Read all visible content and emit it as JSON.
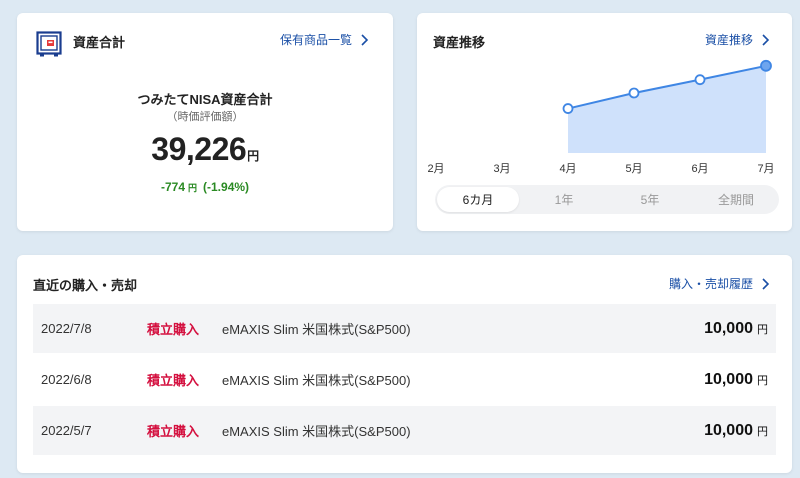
{
  "assets_card": {
    "title": "資産合計",
    "link_label": "保有商品一覧",
    "nisa_label": "つみたてNISA資産合計",
    "nisa_sub": "（時価評価額）",
    "total_value": "39,226",
    "total_unit": "円",
    "change_value": "-774",
    "change_unit": "円",
    "change_percent": "(-1.94%)"
  },
  "trend_card": {
    "title": "資産推移",
    "link_label": "資産推移",
    "tabs": [
      {
        "label": "6カ月",
        "active": true
      },
      {
        "label": "1年",
        "active": false
      },
      {
        "label": "5年",
        "active": false
      },
      {
        "label": "全期間",
        "active": false
      }
    ]
  },
  "history_card": {
    "title": "直近の購入・売却",
    "link_label": "購入・売却履歴",
    "rows": [
      {
        "date": "2022/7/8",
        "type": "積立購入",
        "fund": "eMAXIS Slim 米国株式(S&P500)",
        "amount": "10,000",
        "unit": "円"
      },
      {
        "date": "2022/6/8",
        "type": "積立購入",
        "fund": "eMAXIS Slim 米国株式(S&P500)",
        "amount": "10,000",
        "unit": "円"
      },
      {
        "date": "2022/5/7",
        "type": "積立購入",
        "fund": "eMAXIS Slim 米国株式(S&P500)",
        "amount": "10,000",
        "unit": "円"
      }
    ]
  },
  "colors": {
    "accent_blue": "#1a4fa6",
    "line_blue": "#3f86e4",
    "area_blue": "#cfe1fb",
    "buy_red": "#d4103f",
    "change_green": "#2a8a23"
  },
  "chart_data": {
    "type": "area",
    "x": [
      "2月",
      "3月",
      "4月",
      "5月",
      "6月",
      "7月"
    ],
    "series": [
      {
        "values": [
          null,
          null,
          20000,
          27000,
          33000,
          39226
        ]
      }
    ],
    "ylim": [
      0,
      45000
    ],
    "grid": false
  }
}
